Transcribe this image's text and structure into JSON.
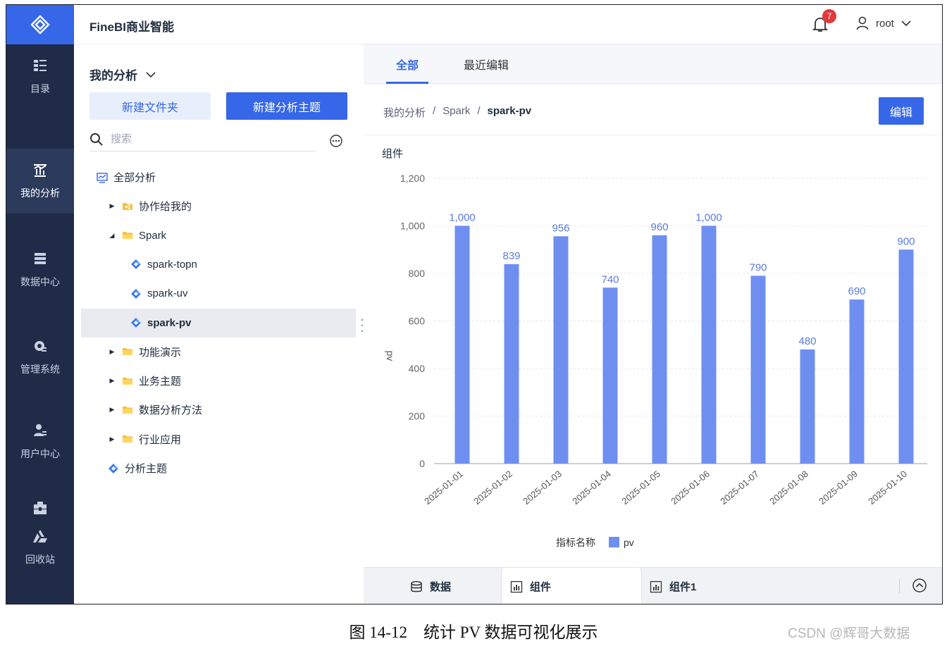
{
  "app": {
    "title": "FineBI商业智能"
  },
  "rail": {
    "items": [
      {
        "label": "目录",
        "icon": "catalog-icon"
      },
      {
        "label": "我的分析",
        "icon": "analysis-icon"
      },
      {
        "label": "数据中心",
        "icon": "database-icon"
      },
      {
        "label": "管理系统",
        "icon": "gear-icon"
      },
      {
        "label": "用户中心",
        "icon": "user-group-icon"
      },
      {
        "label": "回收站",
        "icon": "recycle-icon"
      }
    ],
    "extra_icon": "toolbox-icon",
    "active_index": 1
  },
  "header": {
    "notification_count": "7",
    "username": "root"
  },
  "sidebar": {
    "title": "我的分析",
    "new_folder_label": "新建文件夹",
    "new_subject_label": "新建分析主题",
    "search_placeholder": "搜索",
    "tree": [
      {
        "label": "全部分析",
        "level": 0,
        "type": "all"
      },
      {
        "label": "协作给我的",
        "level": 1,
        "type": "shared-folder",
        "caret": "collapsed"
      },
      {
        "label": "Spark",
        "level": 1,
        "type": "folder-open",
        "caret": "expanded"
      },
      {
        "label": "spark-topn",
        "level": 2,
        "type": "subject"
      },
      {
        "label": "spark-uv",
        "level": 2,
        "type": "subject"
      },
      {
        "label": "spark-pv",
        "level": 2,
        "type": "subject",
        "selected": true
      },
      {
        "label": "功能演示",
        "level": 1,
        "type": "folder",
        "caret": "collapsed"
      },
      {
        "label": "业务主题",
        "level": 1,
        "type": "folder",
        "caret": "collapsed"
      },
      {
        "label": "数据分析方法",
        "level": 1,
        "type": "folder",
        "caret": "collapsed"
      },
      {
        "label": "行业应用",
        "level": 1,
        "type": "folder",
        "caret": "collapsed"
      },
      {
        "label": "分析主题",
        "level": 1,
        "type": "subject"
      }
    ]
  },
  "main": {
    "tabs": [
      {
        "label": "全部"
      },
      {
        "label": "最近编辑"
      }
    ],
    "breadcrumb": [
      "我的分析",
      "Spark",
      "spark-pv"
    ],
    "edit_label": "编辑",
    "widget_title": "组件",
    "bottom_tabs": [
      {
        "label": "数据"
      },
      {
        "label": "组件"
      },
      {
        "label": "组件1"
      }
    ]
  },
  "chart_data": {
    "type": "bar",
    "categories": [
      "2025-01-01",
      "2025-01-02",
      "2025-01-03",
      "2025-01-04",
      "2025-01-05",
      "2025-01-06",
      "2025-01-07",
      "2025-01-08",
      "2025-01-09",
      "2025-01-10"
    ],
    "series": [
      {
        "name": "pv",
        "values": [
          1000,
          839,
          956,
          740,
          960,
          1000,
          790,
          480,
          690,
          900
        ]
      }
    ],
    "data_labels": [
      "1,000",
      "839",
      "956",
      "740",
      "960",
      "1,000",
      "790",
      "480",
      "690",
      "900"
    ],
    "ylabel": "pv",
    "ylim": [
      0,
      1200
    ],
    "yticks": [
      "0",
      "200",
      "400",
      "600",
      "800",
      "1,000",
      "1,200"
    ],
    "legend_title": "指标名称",
    "legend_position": "bottom",
    "grid": true,
    "color": "#6f8ff0"
  },
  "caption": "图 14-12　统计 PV 数据可视化展示",
  "watermark": "CSDN @辉哥大数据"
}
